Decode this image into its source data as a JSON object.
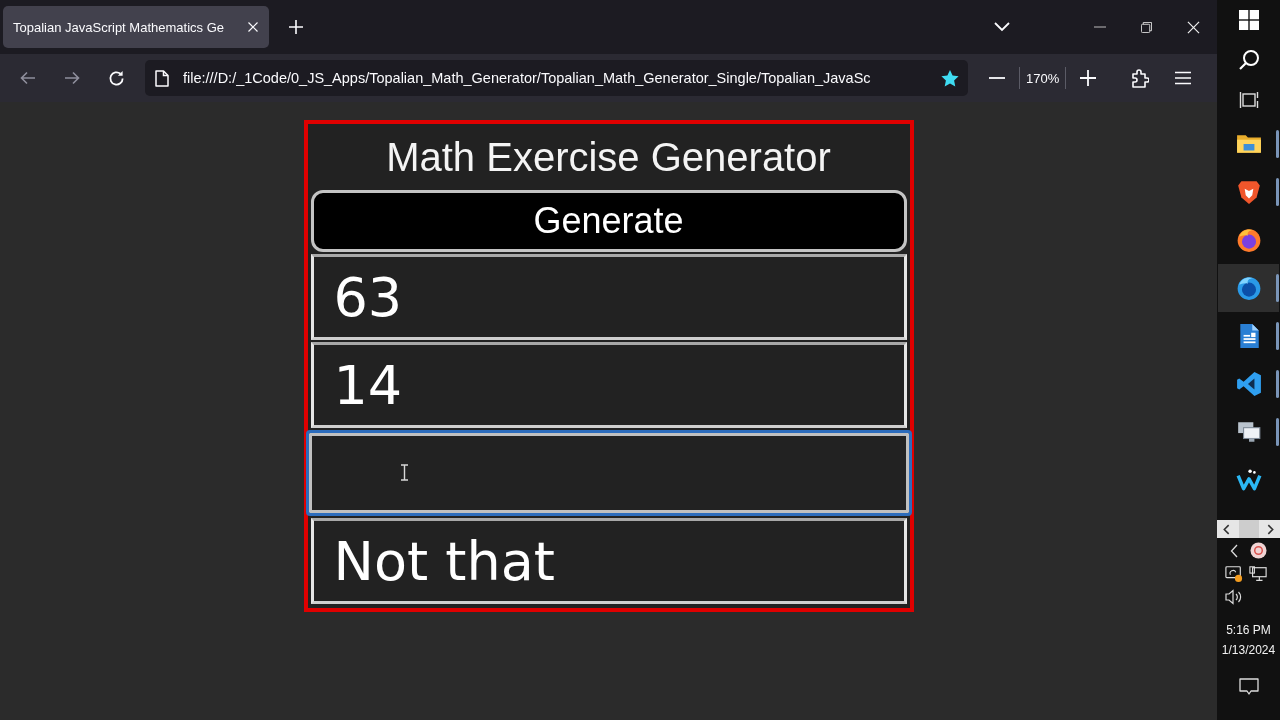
{
  "browser": {
    "tabs": [
      {
        "title": "Topalian JavaScript Mathematics Ge",
        "selected": true
      }
    ],
    "toolbar": {
      "back": {
        "disabled": true
      },
      "forward": {
        "disabled": true
      },
      "address": "file:///D:/_1Code/0_JS_Apps/Topalian_Math_Generator/Topalian_Math_Generator_Single/Topalian_JavaSc",
      "bookmarked": true,
      "zoom": "170%"
    }
  },
  "app": {
    "title": "Math Exercise Generator",
    "button": "Generate",
    "fields": [
      {
        "value": "63",
        "focused": false
      },
      {
        "value": "14",
        "focused": false
      },
      {
        "focused": true
      },
      {
        "value": "Not that",
        "focused": false
      }
    ]
  },
  "taskbar": {
    "apps": [
      {
        "kind": "folder",
        "selected": false,
        "running": true
      },
      {
        "kind": "lion",
        "selected": false,
        "running": true
      },
      {
        "kind": "fox",
        "selected": false,
        "running": false
      },
      {
        "kind": "globe",
        "selected": true,
        "running": true
      },
      {
        "kind": "document",
        "selected": false,
        "running": true
      },
      {
        "kind": "code",
        "selected": false,
        "running": true
      },
      {
        "kind": "monitors",
        "selected": false,
        "running": true
      },
      {
        "kind": "wave",
        "selected": false,
        "running": false
      }
    ],
    "time": "5:16 PM",
    "date": "1/13/2024"
  }
}
